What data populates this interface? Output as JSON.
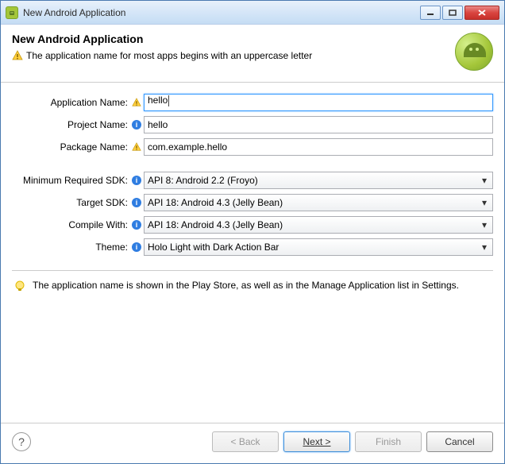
{
  "window": {
    "title": "New Android Application"
  },
  "header": {
    "heading": "New Android Application",
    "message": "The application name for most apps begins with an uppercase letter"
  },
  "form": {
    "app_name": {
      "label": "Application Name:",
      "value": "hello"
    },
    "project_name": {
      "label": "Project Name:",
      "value": "hello"
    },
    "package_name": {
      "label": "Package Name:",
      "value": "com.example.hello"
    },
    "min_sdk": {
      "label": "Minimum Required SDK:",
      "value": "API 8: Android 2.2 (Froyo)"
    },
    "target_sdk": {
      "label": "Target SDK:",
      "value": "API 18: Android 4.3 (Jelly Bean)"
    },
    "compile": {
      "label": "Compile With:",
      "value": "API 18: Android 4.3 (Jelly Bean)"
    },
    "theme": {
      "label": "Theme:",
      "value": "Holo Light with Dark Action Bar"
    }
  },
  "hint": "The application name is shown in the Play Store, as well as in the Manage Application list in Settings.",
  "buttons": {
    "back": "< Back",
    "next": "Next >",
    "finish": "Finish",
    "cancel": "Cancel"
  }
}
